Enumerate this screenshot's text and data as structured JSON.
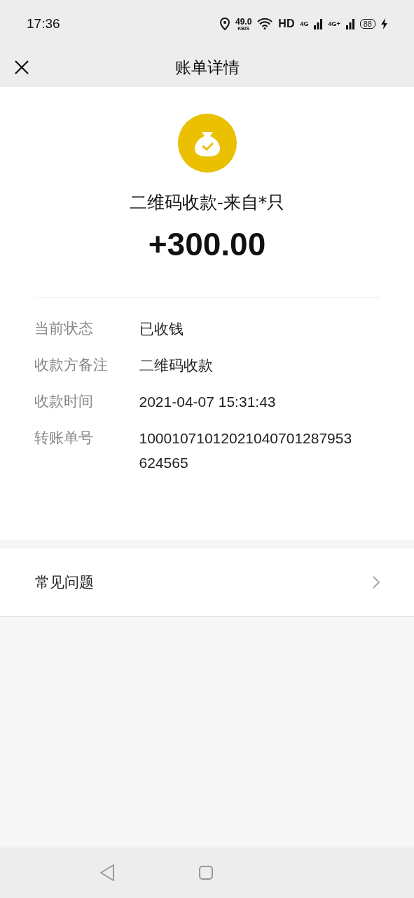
{
  "status_bar": {
    "time": "17:36",
    "speed": "49.0",
    "speed_unit": "KB/S",
    "hd": "HD",
    "networks": [
      "4G",
      "4G+"
    ],
    "battery": "88"
  },
  "header": {
    "title": "账单详情"
  },
  "summary": {
    "title": "二维码收款-来自*只",
    "amount": "+300.00"
  },
  "details": [
    {
      "label": "当前状态",
      "value": "已收钱"
    },
    {
      "label": "收款方备注",
      "value": "二维码收款"
    },
    {
      "label": "收款时间",
      "value": "2021-04-07 15:31:43"
    },
    {
      "label": "转账单号",
      "value": "10001071012021040701287953624565"
    }
  ],
  "faq": {
    "label": "常见问题"
  }
}
